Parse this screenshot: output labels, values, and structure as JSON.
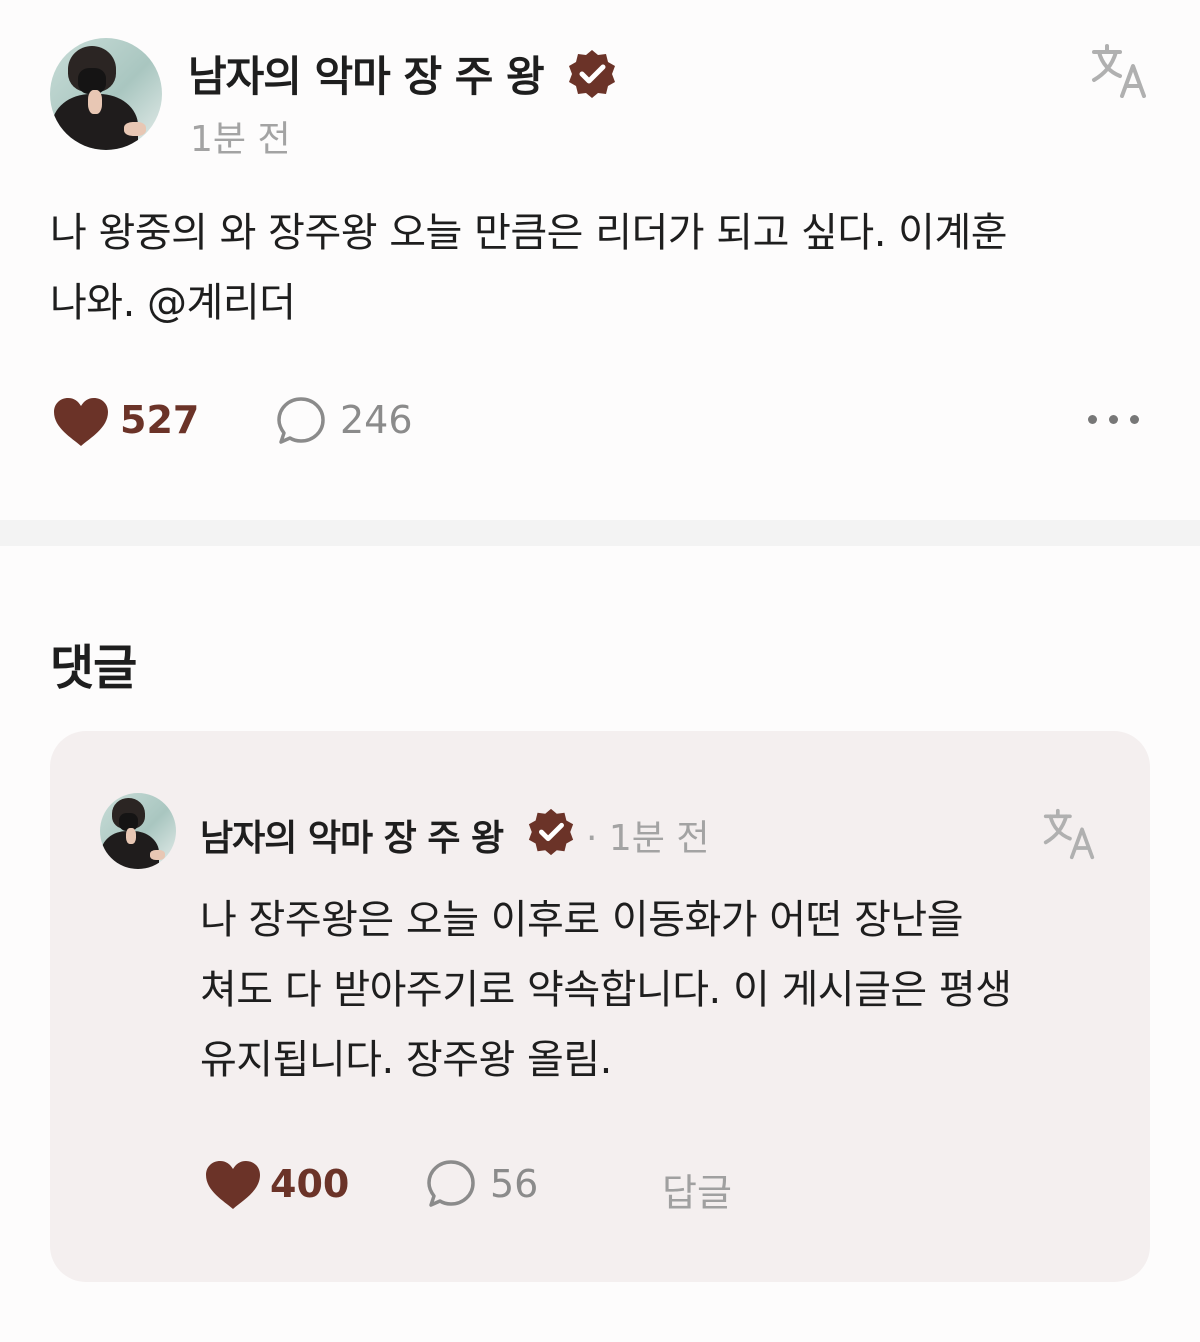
{
  "post": {
    "author": "남자의 악마 장 주 왕",
    "time": "1분 전",
    "text_line1": "나 왕중의 와 장주왕 오늘 만큼은 리더가 되고 싶다. 이계훈",
    "text_line2": "나와. @계리더",
    "likes": "527",
    "comments": "246"
  },
  "section": {
    "title": "댓글"
  },
  "comment": {
    "author": "남자의 악마 장 주 왕",
    "time": "· 1분 전",
    "text_line1": "나 장주왕은 오늘 이후로 이동화가 어떤 장난을",
    "text_line2": "쳐도 다 받아주기로 약속합니다. 이 게시글은 평생",
    "text_line3": "유지됩니다. 장주왕 올림.",
    "likes": "400",
    "comments": "56",
    "reply_label": "답글"
  },
  "icons": {
    "verified": "verified-badge-icon",
    "translate": "translate-icon",
    "like": "heart-icon",
    "comment": "comment-bubble-icon",
    "more": "more-dots-icon"
  },
  "colors": {
    "accent": "#6b3328",
    "muted": "#a3a3a3",
    "card": "#f4efef",
    "divider": "#f3f3f3"
  }
}
